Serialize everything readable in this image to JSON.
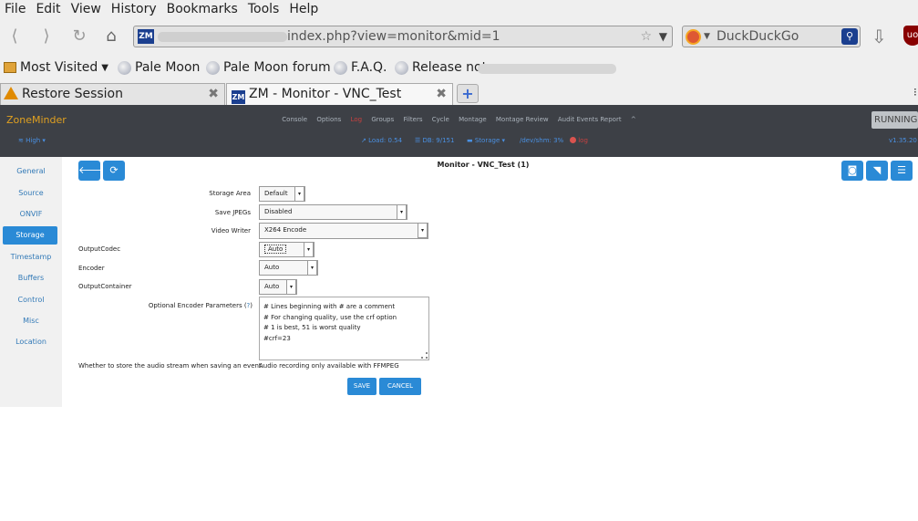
{
  "browser": {
    "menu": [
      "File",
      "Edit",
      "View",
      "History",
      "Bookmarks",
      "Tools",
      "Help"
    ],
    "url": "index.php?view=monitor&mid=1",
    "search_placeholder": "DuckDuckGo",
    "bookmarks": [
      "Most Visited",
      "Pale Moon",
      "Pale Moon forum",
      "F.A.Q.",
      "Release notes"
    ],
    "tabs": [
      {
        "title": "Restore Session"
      },
      {
        "title": "ZM - Monitor - VNC_Test"
      }
    ],
    "tab_close": "✖",
    "new_tab": "+"
  },
  "zm": {
    "brand": "ZoneMinder",
    "nav": [
      "Console",
      "Options",
      "Log",
      "Groups",
      "Filters",
      "Cycle",
      "Montage",
      "Montage Review",
      "Audit Events Report",
      "^"
    ],
    "running": "RUNNING",
    "bandwidth": "High ▾",
    "load": "Load: 0.54",
    "db": "DB: 9/151",
    "storage": "Storage ▾",
    "shm": "/dev/shm: 3%",
    "log_status": "log",
    "version": "v1.35.20"
  },
  "sidebar": {
    "items": [
      "General",
      "Source",
      "ONVIF",
      "Storage",
      "Timestamp",
      "Buffers",
      "Control",
      "Misc",
      "Location"
    ],
    "active_index": 3
  },
  "page": {
    "title": "Monitor - VNC_Test (1)"
  },
  "form": {
    "storage_area_label": "Storage Area",
    "storage_area_value": "Default",
    "save_jpegs_label": "Save JPEGs",
    "save_jpegs_value": "Disabled",
    "video_writer_label": "Video Writer",
    "video_writer_value": "X264 Encode",
    "output_codec_label": "OutputCodec",
    "output_codec_value": "Auto",
    "encoder_label": "Encoder",
    "encoder_value": "Auto",
    "output_container_label": "OutputContainer",
    "output_container_value": "Auto",
    "optional_params_label": "Optional Encoder Parameters (",
    "optional_params_help": "?",
    "optional_params_close": ")",
    "optional_params_lines": [
      "# Lines beginning with # are a comment",
      "# For changing quality, use the crf option",
      "# 1 is best, 51 is worst quality",
      "#crf=23"
    ],
    "audio_label": "Whether to store the audio stream when saving an event.",
    "audio_value": "Audio recording only available with FFMPEG",
    "save_button": "SAVE",
    "cancel_button": "CANCEL"
  }
}
